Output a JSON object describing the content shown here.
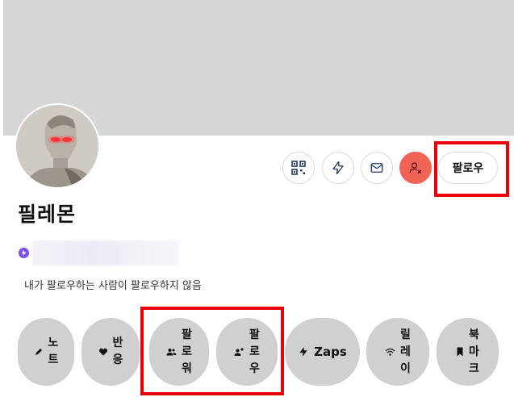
{
  "profile": {
    "display_name": "필레몬",
    "follow_status_note": "내가 팔로우하는 사람이 팔로우하지 않음",
    "follow_label": "팔로우"
  },
  "actions": {
    "icons": [
      "qr-code-icon",
      "zap-icon",
      "mail-icon",
      "user-mute-icon"
    ]
  },
  "tabs": [
    {
      "id": "notes",
      "icon": "pencil-icon",
      "chars": [
        "노",
        "트"
      ]
    },
    {
      "id": "reactions",
      "icon": "heart-icon",
      "chars": [
        "반",
        "응"
      ]
    },
    {
      "id": "followers",
      "icon": "users-icon",
      "chars": [
        "팔",
        "로",
        "워"
      ]
    },
    {
      "id": "following",
      "icon": "user-plus-icon",
      "chars": [
        "팔",
        "로",
        "우"
      ]
    },
    {
      "id": "zaps",
      "icon": "zap-icon",
      "label": "Zaps"
    },
    {
      "id": "relays",
      "icon": "wifi-icon",
      "chars": [
        "릴",
        "레",
        "이"
      ]
    },
    {
      "id": "bookmarks",
      "icon": "bookmark-icon",
      "chars": [
        "북",
        "마",
        "크"
      ]
    }
  ],
  "colors": {
    "banner": "#d6d6d6",
    "mute_button": "#f16257",
    "verified_badge": "#7b4ef0",
    "tab_background": "#d0d0d0",
    "highlight_box": "#e8000b"
  }
}
